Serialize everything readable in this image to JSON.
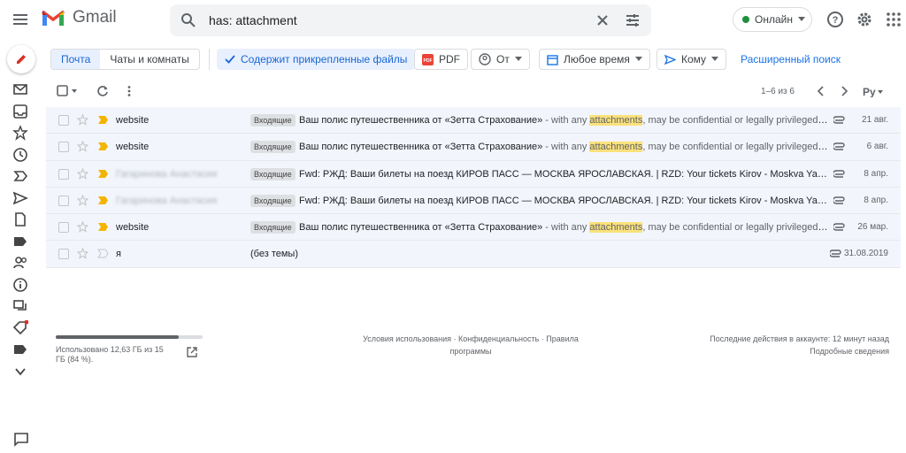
{
  "app": {
    "name": "Gmail"
  },
  "search": {
    "query": "has: attachment"
  },
  "status": {
    "label": "Онлайн",
    "color": "#1e8e3e"
  },
  "segments": [
    {
      "label": "Почта",
      "active": true
    },
    {
      "label": "Чаты и комнаты",
      "active": false
    }
  ],
  "filters": {
    "has_attachment": "Содержит прикрепленные файлы",
    "pdf": "PDF",
    "from": "От",
    "time": "Любое время",
    "to": "Кому",
    "advanced": "Расширенный поиск"
  },
  "pager": {
    "text": "1–6 из 6"
  },
  "emails": [
    {
      "sender": "website",
      "blurred": false,
      "important": true,
      "label": "Входящие",
      "subject": "Ваш полис путешественника от «Зетта Страхование»",
      "snippet_pre": " - with any ",
      "highlight": "attachments",
      "snippet_post": ", may be confidential or legally privileged. I...",
      "date": "21 авг."
    },
    {
      "sender": "website",
      "blurred": false,
      "important": true,
      "label": "Входящие",
      "subject": "Ваш полис путешественника от «Зетта Страхование»",
      "snippet_pre": " - with any ",
      "highlight": "attachments",
      "snippet_post": ", may be confidential or legally privileged. I...",
      "date": "6 авг."
    },
    {
      "sender": "Гагаринова Анастасия",
      "blurred": true,
      "important": true,
      "label": "Входящие",
      "subject": "Fwd: РЖД: Ваши билеты на поезд КИРОВ ПАСС — МОСКВА ЯРОСЛАВСКАЯ. | RZD: Your tickets Kirov - Moskva Yarosla...",
      "snippet_pre": "",
      "highlight": "",
      "snippet_post": "",
      "date": "8 апр."
    },
    {
      "sender": "Гагаринова Анастасия",
      "blurred": true,
      "important": true,
      "label": "Входящие",
      "subject": "Fwd: РЖД: Ваши билеты на поезд КИРОВ ПАСС — МОСКВА ЯРОСЛАВСКАЯ. | RZD: Your tickets Kirov - Moskva Yarosla...",
      "snippet_pre": "",
      "highlight": "",
      "snippet_post": "",
      "date": "8 апр."
    },
    {
      "sender": "website",
      "blurred": false,
      "important": true,
      "label": "Входящие",
      "subject": "Ваш полис путешественника от «Зетта Страхование»",
      "snippet_pre": " - with any ",
      "highlight": "attachments",
      "snippet_post": ", may be confidential or legally privileged. I...",
      "date": "26 мар."
    },
    {
      "sender": "я",
      "blurred": false,
      "important": false,
      "label": "",
      "subject": "(без темы)",
      "snippet_pre": "",
      "highlight": "",
      "snippet_post": "",
      "date": "31.08.2019"
    }
  ],
  "footer": {
    "storage_text": "Использовано 12,63 ГБ из 15 ГБ (84 %).",
    "storage_used_fraction": 0.84,
    "links_line1": "Условия использования · Конфиденциальность · Правила",
    "links_line2": "программы",
    "activity_line1": "Последние действия в аккаунте: 12 минут назад",
    "activity_line2": "Подробные сведения"
  }
}
